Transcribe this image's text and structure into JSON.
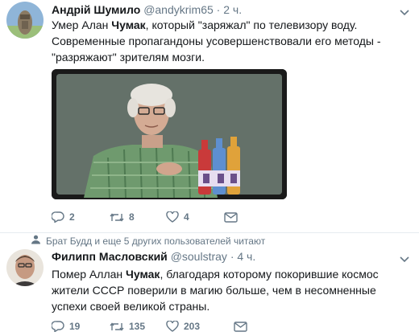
{
  "tweets": [
    {
      "author_name": "Андрій Шумило",
      "author_handle": "@andykrim65",
      "separator": "·",
      "time": "2 ч.",
      "text_before": "Умер Алан ",
      "text_bold": "Чумак",
      "text_after": ",  который \"заряжал\" по телевизору воду. Современные пропагандоны усовершенствовали его методы - \"разряжают\" зрителям мозги.",
      "replies": "2",
      "retweets": "8",
      "likes": "4"
    },
    {
      "context": "Брат Будд и еще 5 других пользователей читают",
      "author_name": "Филипп Масловский",
      "author_handle": "@soulstray",
      "separator": "·",
      "time": "4 ч.",
      "text_before": "Помер Аллан ",
      "text_bold": "Чумак",
      "text_after": ", благодаря которому покорившие космос жители СССР поверили в магию больше, чем в несомненные успехи своей великой страны.",
      "replies": "19",
      "retweets": "135",
      "likes": "203"
    }
  ],
  "colors": {
    "text": "#14171a",
    "secondary": "#657786",
    "divider": "#e6ecf0"
  },
  "icons": [
    "reply-icon",
    "retweet-icon",
    "like-icon",
    "dm-icon",
    "chevron-down-icon",
    "people-icon"
  ]
}
